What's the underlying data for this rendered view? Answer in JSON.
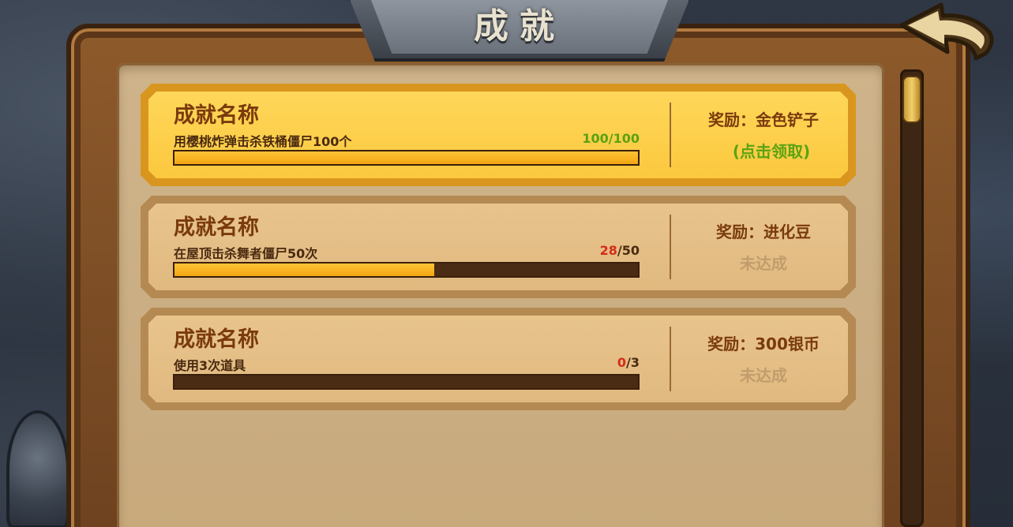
{
  "header": {
    "title": "成就"
  },
  "achievements": [
    {
      "name": "成就名称",
      "description": "用樱桃炸弹击杀铁桶僵尸100个",
      "progress_current": "100",
      "progress_sep": "/",
      "progress_total": "100",
      "progress_fraction": 1.0,
      "reward": "奖励：金色铲子",
      "status": "(点击领取)",
      "state": "claimable"
    },
    {
      "name": "成就名称",
      "description": "在屋顶击杀舞者僵尸50次",
      "progress_current": "28",
      "progress_sep": "/",
      "progress_total": "50",
      "progress_fraction": 0.56,
      "reward": "奖励：进化豆",
      "status": "未达成",
      "state": "incomplete"
    },
    {
      "name": "成就名称",
      "description": "使用3次道具",
      "progress_current": "0",
      "progress_sep": "/",
      "progress_total": "3",
      "progress_fraction": 0,
      "reward": "奖励：300银币",
      "status": "未达成",
      "state": "incomplete"
    }
  ],
  "colors": {
    "claimable_card": "#fbc83e",
    "incomplete_card": "#e0b97f",
    "claim_text": "#5aa312",
    "progress_current_red": "#d62c1a",
    "bar_fill": "#f4a512"
  },
  "icons": {
    "back": "back-arrow-icon"
  }
}
